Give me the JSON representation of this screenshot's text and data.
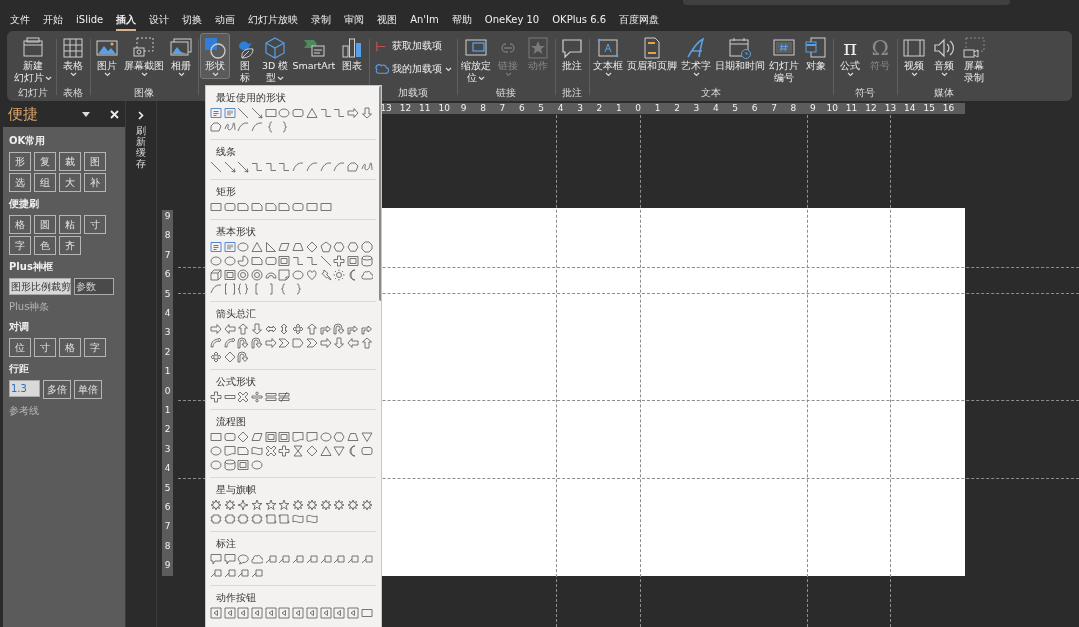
{
  "menu_tabs": [
    {
      "label": "文件",
      "selected": false
    },
    {
      "label": "开始",
      "selected": false
    },
    {
      "label": "iSlide",
      "selected": false
    },
    {
      "label": "插入",
      "selected": true
    },
    {
      "label": "设计",
      "selected": false
    },
    {
      "label": "切换",
      "selected": false
    },
    {
      "label": "动画",
      "selected": false
    },
    {
      "label": "幻灯片放映",
      "selected": false
    },
    {
      "label": "录制",
      "selected": false
    },
    {
      "label": "审阅",
      "selected": false
    },
    {
      "label": "视图",
      "selected": false
    },
    {
      "label": "An'Im",
      "selected": false
    },
    {
      "label": "帮助",
      "selected": false
    },
    {
      "label": "OneKey 10",
      "selected": false
    },
    {
      "label": "OKPlus 6.6",
      "selected": false
    },
    {
      "label": "百度网盘",
      "selected": false
    }
  ],
  "ribbon": {
    "groups": [
      {
        "label": "幻灯片",
        "buttons": [
          {
            "kind": "large",
            "lines": [
              "新建",
              "幻灯片"
            ],
            "dropdown": true,
            "disabled": false,
            "selected": false
          }
        ]
      },
      {
        "label": "表格",
        "buttons": [
          {
            "kind": "large",
            "lines": [
              "表格"
            ],
            "dropdown": true,
            "disabled": false,
            "selected": false
          }
        ]
      },
      {
        "label": "图像",
        "buttons": [
          {
            "kind": "large",
            "lines": [
              "图片"
            ],
            "dropdown": true,
            "disabled": false,
            "selected": false
          },
          {
            "kind": "large",
            "lines": [
              "屏幕截图"
            ],
            "dropdown": true,
            "disabled": false,
            "selected": false
          },
          {
            "kind": "large",
            "lines": [
              "相册"
            ],
            "dropdown": true,
            "disabled": false,
            "selected": false
          }
        ]
      },
      {
        "buttons": [
          {
            "kind": "large",
            "lines": [
              "形状"
            ],
            "dropdown": true,
            "disabled": false,
            "selected": true
          },
          {
            "kind": "large",
            "lines": [
              "图",
              "标"
            ],
            "dropdown": false,
            "disabled": false,
            "selected": false
          },
          {
            "kind": "large",
            "lines": [
              "3D 模",
              "型"
            ],
            "dropdown": true,
            "disabled": false,
            "selected": false
          },
          {
            "kind": "large",
            "lines": [
              "SmartArt"
            ],
            "dropdown": false,
            "disabled": false,
            "selected": false
          },
          {
            "kind": "large",
            "lines": [
              "图表"
            ],
            "dropdown": false,
            "disabled": false,
            "selected": false
          }
        ]
      },
      {
        "label": "加载项",
        "buttons": [
          {
            "kind": "small",
            "lines": [
              "获取加载项"
            ],
            "dropdown": false,
            "disabled": false,
            "selected": false
          },
          {
            "kind": "small",
            "lines": [
              "我的加载项"
            ],
            "dropdown": true,
            "disabled": false,
            "selected": false
          }
        ]
      },
      {
        "label": "链接",
        "buttons": [
          {
            "kind": "large",
            "lines": [
              "缩放定",
              "位"
            ],
            "dropdown": true,
            "disabled": false,
            "selected": false
          },
          {
            "kind": "large",
            "lines": [
              "链接"
            ],
            "dropdown": true,
            "disabled": true,
            "selected": false
          },
          {
            "kind": "large",
            "lines": [
              "动作"
            ],
            "dropdown": false,
            "disabled": true,
            "selected": false
          }
        ]
      },
      {
        "label": "批注",
        "buttons": [
          {
            "kind": "large",
            "lines": [
              "批注"
            ],
            "dropdown": false,
            "disabled": false,
            "selected": false
          }
        ]
      },
      {
        "label": "文本",
        "buttons": [
          {
            "kind": "large",
            "lines": [
              "文本框"
            ],
            "dropdown": true,
            "disabled": false,
            "selected": false
          },
          {
            "kind": "large",
            "lines": [
              "页眉和页脚"
            ],
            "dropdown": false,
            "disabled": false,
            "selected": false
          },
          {
            "kind": "large",
            "lines": [
              "艺术字"
            ],
            "dropdown": true,
            "disabled": false,
            "selected": false
          },
          {
            "kind": "large",
            "lines": [
              "日期和时间"
            ],
            "dropdown": false,
            "disabled": false,
            "selected": false
          },
          {
            "kind": "large",
            "lines": [
              "幻灯片",
              "编号"
            ],
            "dropdown": false,
            "disabled": false,
            "selected": false
          },
          {
            "kind": "large",
            "lines": [
              "对象"
            ],
            "dropdown": false,
            "disabled": false,
            "selected": false
          }
        ]
      },
      {
        "label": "符号",
        "buttons": [
          {
            "kind": "glyph",
            "glyph": "π",
            "lines": [
              "公式"
            ],
            "dropdown": true,
            "disabled": false,
            "selected": false
          },
          {
            "kind": "glyph",
            "glyph": "Ω",
            "lines": [
              "符号"
            ],
            "dropdown": false,
            "disabled": true,
            "selected": false
          }
        ]
      },
      {
        "label": "媒体",
        "buttons": [
          {
            "kind": "large",
            "lines": [
              "视频"
            ],
            "dropdown": true,
            "disabled": false,
            "selected": false
          },
          {
            "kind": "large",
            "lines": [
              "音频"
            ],
            "dropdown": true,
            "disabled": false,
            "selected": false
          },
          {
            "kind": "large",
            "lines": [
              "屏幕",
              "录制"
            ],
            "dropdown": false,
            "disabled": false,
            "selected": false
          }
        ]
      }
    ]
  },
  "side_pane": {
    "title": "便捷",
    "sections": [
      {
        "kind": "buttons",
        "title": "OK常用",
        "disabled": false,
        "buttons": [
          "形",
          "复",
          "裁",
          "图",
          "选",
          "组",
          "大",
          "补"
        ]
      },
      {
        "kind": "buttons",
        "title": "便捷刷",
        "disabled": false,
        "buttons": [
          "格",
          "圆",
          "粘",
          "寸",
          "字",
          "色",
          "齐"
        ]
      },
      {
        "kind": "fields",
        "title": "Plus神框",
        "disabled": false,
        "value": "图形比例裁剪",
        "placeholder": "参数"
      },
      {
        "kind": "label",
        "title": "Plus神条",
        "disabled": true
      },
      {
        "kind": "buttons",
        "title": "对调",
        "disabled": false,
        "buttons": [
          "位",
          "寸",
          "格",
          "字"
        ]
      },
      {
        "kind": "spacing",
        "title": "行距",
        "disabled": false,
        "value": "1.3",
        "buttons": [
          "多倍",
          "单倍"
        ]
      },
      {
        "kind": "label",
        "title": "参考线",
        "disabled": true
      }
    ]
  },
  "collapsed_pane": {
    "label": "刷新缓存"
  },
  "horizontal_ruler": {
    "labels": [
      "13",
      "12",
      "11",
      "10",
      "9",
      "8",
      "7",
      "6",
      "5",
      "4",
      "3",
      "2",
      "1",
      "0",
      "1",
      "2",
      "3",
      "4",
      "5",
      "6",
      "7",
      "8",
      "9",
      "10",
      "11",
      "12",
      "13",
      "14",
      "15",
      "16"
    ]
  },
  "vertical_ruler": {
    "labels": [
      "9",
      "8",
      "7",
      "6",
      "5",
      "4",
      "3",
      "2",
      "1",
      "0",
      "1",
      "2",
      "3",
      "4",
      "5",
      "6",
      "7",
      "8",
      "9"
    ]
  },
  "shapes_menu": {
    "sections": [
      {
        "title": "最近使用的形状"
      },
      {
        "title": "线条"
      },
      {
        "title": "矩形"
      },
      {
        "title": "基本形状"
      },
      {
        "title": "箭头总汇"
      },
      {
        "title": "公式形状"
      },
      {
        "title": "流程图"
      },
      {
        "title": "星与旗帜"
      },
      {
        "title": "标注"
      },
      {
        "title": "动作按钮"
      }
    ]
  }
}
